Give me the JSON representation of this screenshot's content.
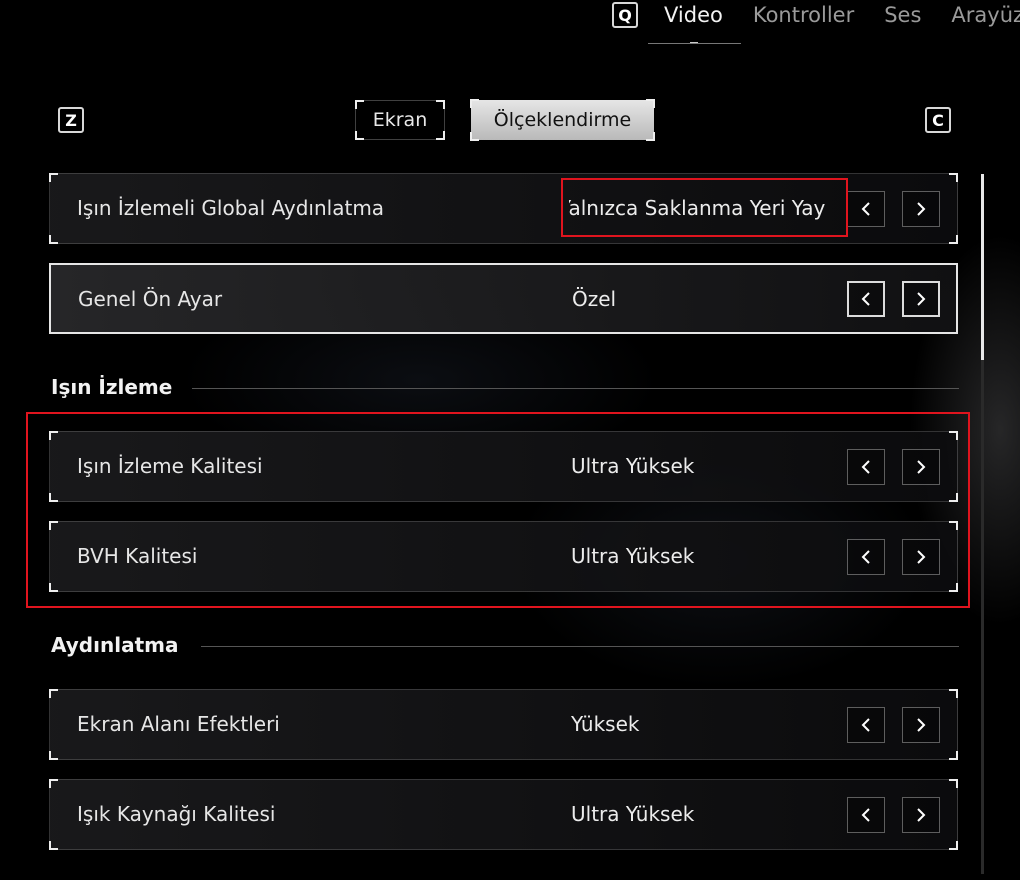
{
  "top_nav": {
    "left_key": "Q",
    "tabs": [
      {
        "label": "Video",
        "active": true
      },
      {
        "label": "Kontroller",
        "active": false
      },
      {
        "label": "Ses",
        "active": false
      },
      {
        "label": "Arayüz",
        "active": false
      }
    ]
  },
  "sub_nav": {
    "left_key": "Z",
    "right_key": "C",
    "tabs": [
      {
        "label": "Ekran",
        "active": false
      },
      {
        "label": "Ölçeklendirme",
        "active": true
      }
    ]
  },
  "rows_top": [
    {
      "label": "Işın İzlemeli Global Aydınlatma",
      "value": "Yalnızca Saklanma Yeri Yay"
    },
    {
      "label": "Genel Ön Ayar",
      "value": "Özel",
      "selected": true
    }
  ],
  "sections": [
    {
      "title": "Işın İzleme",
      "rows": [
        {
          "label": "Işın İzleme Kalitesi",
          "value": "Ultra Yüksek"
        },
        {
          "label": "BVH Kalitesi",
          "value": "Ultra Yüksek"
        }
      ]
    },
    {
      "title": "Aydınlatma",
      "rows": [
        {
          "label": "Ekran Alanı Efektleri",
          "value": "Yüksek"
        },
        {
          "label": "Işık Kaynağı Kalitesi",
          "value": "Ultra Yüksek"
        }
      ]
    }
  ],
  "icons": {
    "prev": "chevron-left-icon",
    "next": "chevron-right-icon"
  },
  "colors": {
    "background": "#000000",
    "annotation": "#e0141e",
    "active_subtab": "#d0d0d0"
  },
  "scroll": {
    "position_fraction": 0.0,
    "visible_fraction": 0.27
  }
}
